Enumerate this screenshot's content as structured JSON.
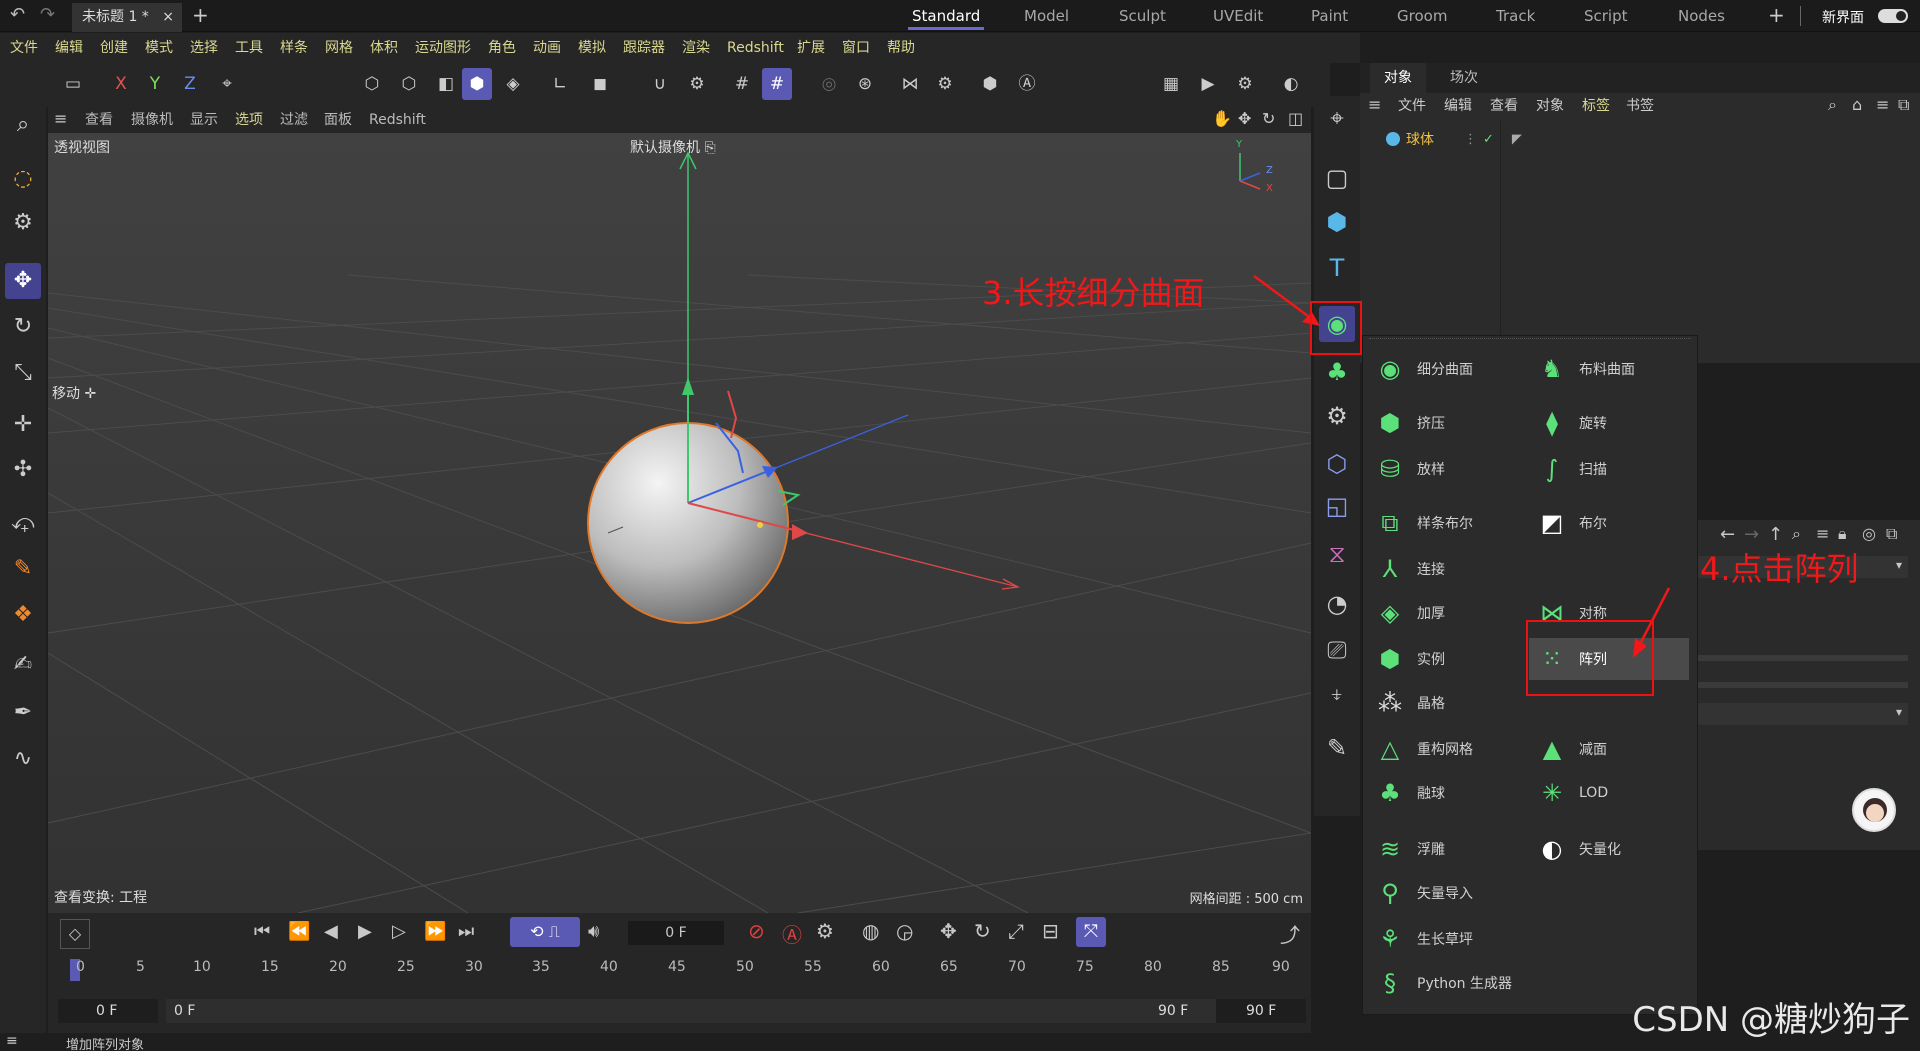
{
  "topbar": {
    "doc_tab": "未标题 1 *",
    "layouts": [
      "Standard",
      "Model",
      "Sculpt",
      "UVEdit",
      "Paint",
      "Groom",
      "Track",
      "Script",
      "Nodes"
    ],
    "new_layout": "新界面"
  },
  "menubar": [
    "文件",
    "编辑",
    "创建",
    "模式",
    "选择",
    "工具",
    "样条",
    "网格",
    "体积",
    "运动图形",
    "角色",
    "动画",
    "模拟",
    "跟踪器",
    "渲染",
    "Redshift",
    "扩展",
    "窗口",
    "帮助"
  ],
  "toolbar": {
    "axis_x": "X",
    "axis_y": "Y",
    "axis_z": "Z"
  },
  "viewport_menu": [
    "查看",
    "摄像机",
    "显示",
    "选项",
    "过滤",
    "面板",
    "Redshift"
  ],
  "viewport": {
    "label": "透视视图",
    "camera": "默认摄像机",
    "tool_label": "移动",
    "footer_left": "查看变换: 工程",
    "footer_right": "网格间距 : 500 cm",
    "axis_y": "Y",
    "axis_z": "Z",
    "axis_x": "X"
  },
  "object_panel": {
    "tabs": [
      "对象",
      "场次"
    ],
    "menu": [
      "文件",
      "编辑",
      "查看",
      "对象",
      "标签",
      "书签"
    ],
    "object_name": "球体"
  },
  "popup": {
    "left": [
      "细分曲面",
      "挤压",
      "放样",
      "样条布尔",
      "连接",
      "加厚",
      "实例",
      "晶格",
      "重构网格",
      "融球",
      "浮雕",
      "矢量导入",
      "生长草坪",
      "Python 生成器"
    ],
    "right": [
      "布料曲面",
      "旋转",
      "扫描",
      "布尔",
      "",
      "对称",
      "阵列",
      "",
      "减面",
      "LOD",
      "矢量化"
    ]
  },
  "timeline": {
    "current_frame": "0 F",
    "ticks": [
      "0",
      "5",
      "10",
      "15",
      "20",
      "25",
      "30",
      "35",
      "40",
      "45",
      "50",
      "55",
      "60",
      "65",
      "70",
      "75",
      "80",
      "85",
      "90"
    ],
    "start": "0 F",
    "start2": "0 F",
    "end": "90 F",
    "end2": "90 F"
  },
  "status": "增加阵列对象",
  "annotations": {
    "step3": "3.长按细分曲面",
    "step4": "4.点击阵列"
  },
  "watermark": "CSDN @糖炒狗子",
  "colors": {
    "accent": "#5a5ab5",
    "green_icon": "#5ce07a",
    "annotation": "#f01818",
    "highlight": "#4a4a4a"
  }
}
